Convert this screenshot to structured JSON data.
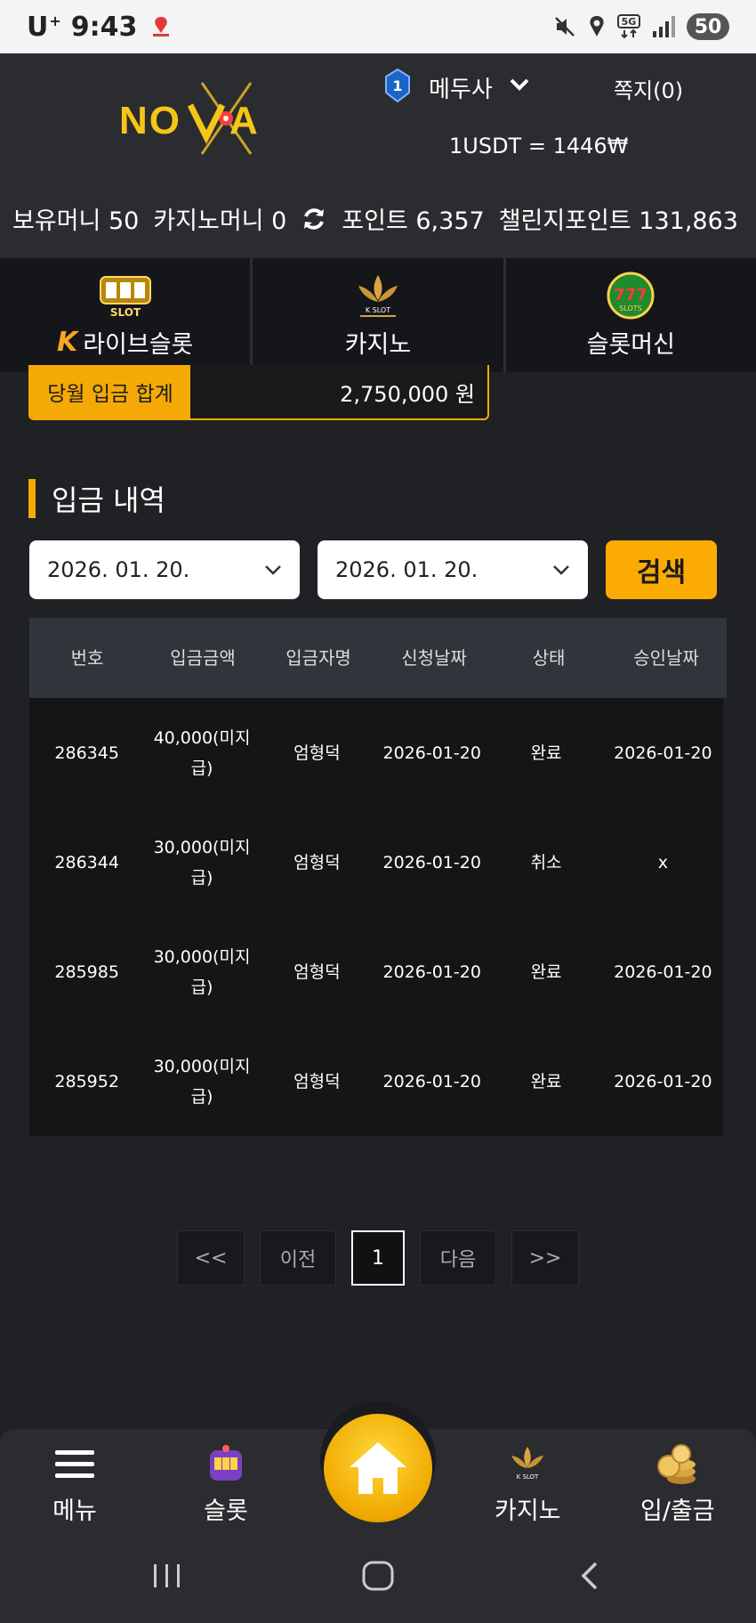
{
  "status_bar": {
    "carrier": "U",
    "carrier_sup": "+",
    "time": "9:43",
    "battery": "50"
  },
  "header": {
    "logo": "NOVA",
    "username": "메두사",
    "messages": "쪽지(0)",
    "rate": "1USDT = 1446₩",
    "balances": {
      "money": "보유머니 50",
      "casino_money": "카지노머니 0",
      "points": "포인트 6,357",
      "challenge_points": "챌린지포인트 131,863"
    }
  },
  "categories": [
    {
      "label": "라이브슬롯",
      "icon": "slot-machine-icon"
    },
    {
      "label": "카지노",
      "icon": "k-slot-lotus-icon"
    },
    {
      "label": "슬롯머신",
      "icon": "777-slots-icon"
    }
  ],
  "summary": {
    "label": "당월 입금 합계",
    "value": "2,750,000 원"
  },
  "section_title": "입금 내역",
  "filter": {
    "date_from": "2026. 01. 20.",
    "date_to": "2026. 01. 20.",
    "search_label": "검색"
  },
  "table": {
    "headers": [
      "번호",
      "입금금액",
      "입금자명",
      "신청날짜",
      "상태",
      "승인날짜"
    ],
    "rows": [
      {
        "id": "286345",
        "amount": "40,000(미지급)",
        "name": "엄형덕",
        "date": "2026-01-20",
        "status": "완료",
        "approved": "2026-01-20"
      },
      {
        "id": "286344",
        "amount": "30,000(미지급)",
        "name": "엄형덕",
        "date": "2026-01-20",
        "status": "취소",
        "approved": "x"
      },
      {
        "id": "285985",
        "amount": "30,000(미지급)",
        "name": "엄형덕",
        "date": "2026-01-20",
        "status": "완료",
        "approved": "2026-01-20"
      },
      {
        "id": "285952",
        "amount": "30,000(미지급)",
        "name": "엄형덕",
        "date": "2026-01-20",
        "status": "완료",
        "approved": "2026-01-20"
      }
    ]
  },
  "pagination": {
    "first": "<<",
    "prev": "이전",
    "current": "1",
    "next": "다음",
    "last": ">>"
  },
  "bottom_nav": {
    "menu": "메뉴",
    "slot": "슬롯",
    "casino": "카지노",
    "deposit": "입/출금"
  },
  "colors": {
    "accent": "#fbab04",
    "background": "#202124",
    "header": "#2b2c2f"
  }
}
